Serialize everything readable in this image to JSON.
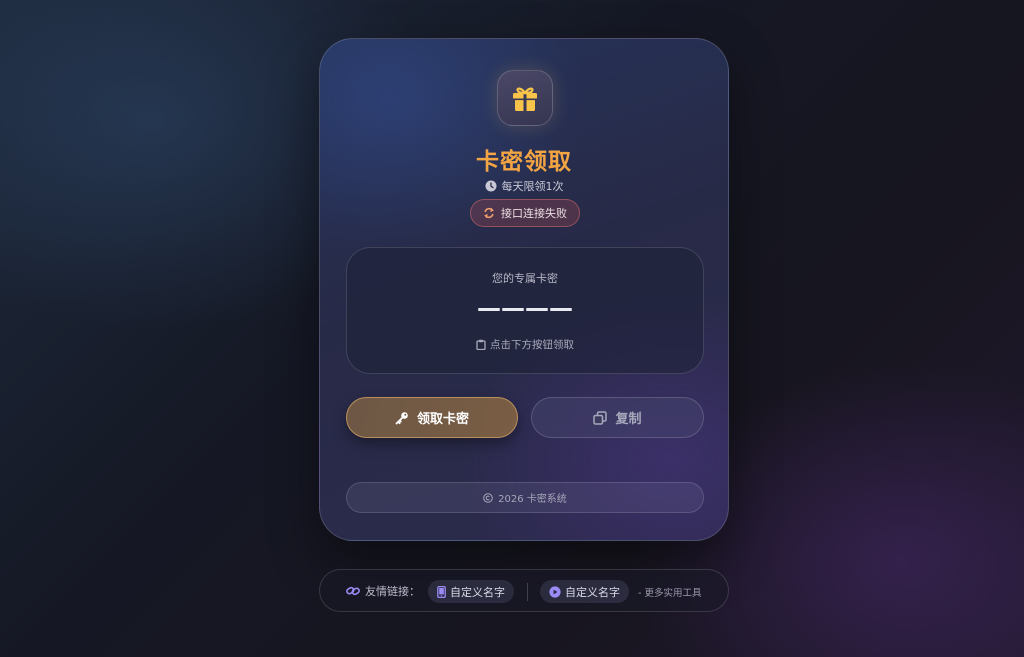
{
  "card": {
    "title": "卡密领取",
    "limit_text": "每天限领1次",
    "status_text": "接口连接失败",
    "code_panel": {
      "label": "您的专属卡密",
      "value": "————",
      "hint": "点击下方按钮领取"
    },
    "get_button_label": "领取卡密",
    "copy_button_label": "复制",
    "footer_text": "2026 卡密系统"
  },
  "links": {
    "label": "友情链接：",
    "items": [
      {
        "label": "自定义名字",
        "icon": "phone-icon"
      },
      {
        "label": "自定义名字",
        "icon": "play-circle-icon"
      }
    ],
    "more_text": "- 更多实用工具"
  },
  "colors": {
    "title": "#f3a443",
    "gift": "#f8c44a",
    "accent_border": "#b98f5d",
    "status_border": "#dc6e6e",
    "link_icon": "#9b8cf5"
  }
}
